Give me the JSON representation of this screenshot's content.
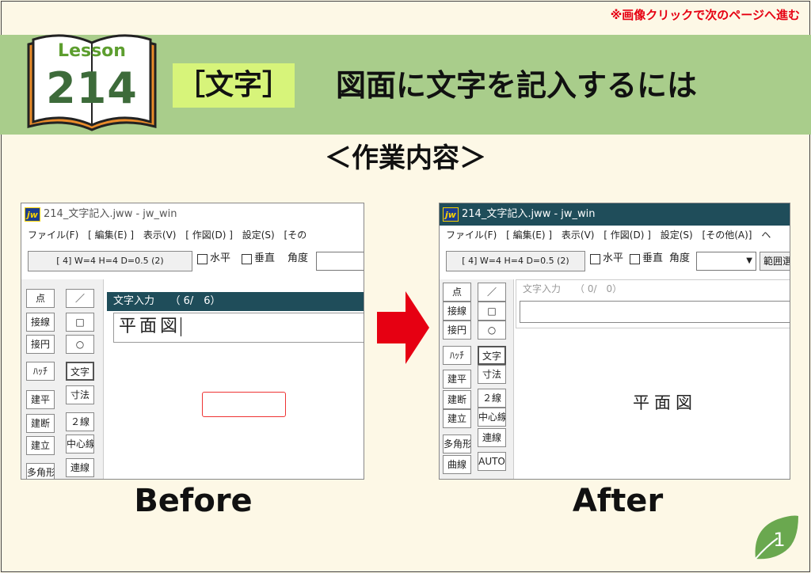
{
  "header": {
    "next_page_hint": "※画像クリックで次のページへ進む",
    "lesson_word": "Lesson",
    "lesson_number": "214",
    "category_tag": "［文字］",
    "title": "図面に文字を記入するには",
    "subtitle": "＜作業内容＞"
  },
  "before": {
    "caption": "Before",
    "window_title": "214_文字記入.jww - jw_win",
    "menus": [
      "ファイル(F)",
      "[ 編集(E) ]",
      "表示(V)",
      "[ 作図(D) ]",
      "設定(S)",
      "[その"
    ],
    "param_button": "[ 4]  W=4  H=4  D=0.5 (2)",
    "horizontal_label": "水平",
    "vertical_label": "垂直",
    "angle_label": "角度",
    "tools_left": [
      "点",
      "接線",
      "接円",
      "ﾊｯﾁ",
      "建平",
      "建断",
      "建立",
      "多角形"
    ],
    "tools_right": [
      "／",
      "□",
      "○",
      "文字",
      "寸法",
      "２線",
      "中心線",
      "連線"
    ],
    "dialog_title": "文字入力　　（ 6/　6）",
    "dialog_value": "平面図"
  },
  "after": {
    "caption": "After",
    "window_title": "214_文字記入.jww - jw_win",
    "menus": [
      "ファイル(F)",
      "[ 編集(E) ]",
      "表示(V)",
      "[ 作図(D) ]",
      "設定(S)",
      "[その他(A)]",
      "ヘ"
    ],
    "param_button": "[ 4]  W=4  H=4  D=0.5 (2)",
    "horizontal_label": "水平",
    "vertical_label": "垂直",
    "angle_label": "角度",
    "range_button": "範囲選",
    "tools_left": [
      "点",
      "接線",
      "接円",
      "ﾊｯﾁ",
      "建平",
      "建断",
      "建立",
      "多角形",
      "曲線"
    ],
    "tools_right": [
      "／",
      "□",
      "○",
      "文字",
      "寸法",
      "２線",
      "中心線",
      "連線",
      "AUTO"
    ],
    "dialog_title": "文字入力　　（ 0/　0）",
    "dialog_value": "",
    "placed_text": "平面図"
  },
  "page_number": "1",
  "icons": {
    "book": "open-book-icon",
    "arrow": "right-arrow-icon",
    "leaf": "leaf-page-icon",
    "logo": "jw-logo-icon"
  },
  "colors": {
    "banner": "#a9cd8b",
    "tag": "#d7f47a",
    "accent_red": "#e60012",
    "titlebar": "#1f4d5a",
    "leaf": "#6aa84f"
  }
}
